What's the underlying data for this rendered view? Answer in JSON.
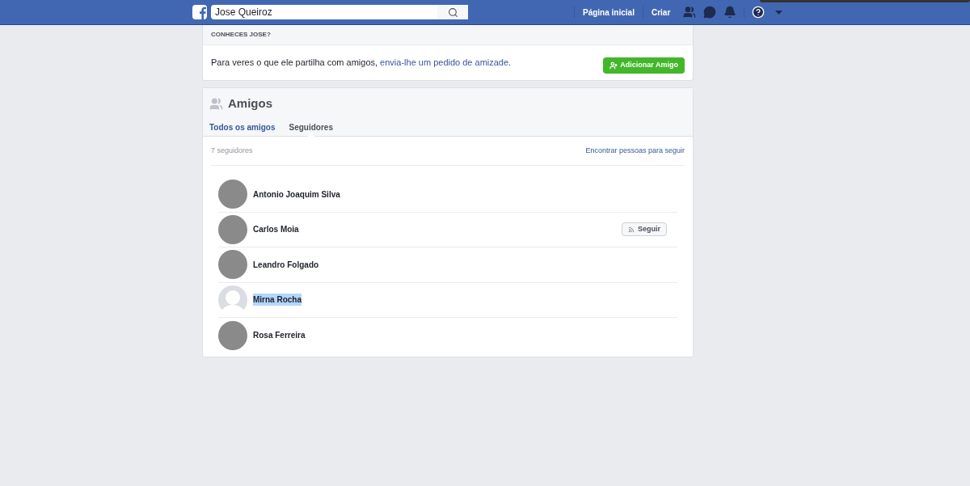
{
  "topbar": {
    "search": {
      "value": "Jose Queiroz"
    },
    "nav": [
      "Página inicial",
      "Criar"
    ]
  },
  "know_card": {
    "title": "CONHECES JOSE?",
    "text": "Para veres o que ele partilha com amigos, ",
    "link": "envia-lhe um pedido de amizade.",
    "button": "Adicionar Amigo"
  },
  "friends": {
    "title": "Amigos",
    "tabs": [
      {
        "label": "Todos os amigos",
        "selected": false
      },
      {
        "label": "Seguidores",
        "selected": true
      }
    ],
    "count": "7 seguidores",
    "find_link": "Encontrar pessoas para seguir",
    "followers": [
      {
        "name": "Antonio Joaquim Silva",
        "kind": "photo",
        "highlighted": false
      },
      {
        "name": "Carlos Moia",
        "kind": "photo",
        "highlighted": false,
        "follow_button": "Seguir"
      },
      {
        "name": "Leandro Folgado",
        "kind": "photo",
        "highlighted": false
      },
      {
        "name": "Mirna Rocha",
        "kind": "silhouette",
        "highlighted": true
      },
      {
        "name": "Rosa Ferreira",
        "kind": "photo",
        "highlighted": false
      }
    ]
  }
}
